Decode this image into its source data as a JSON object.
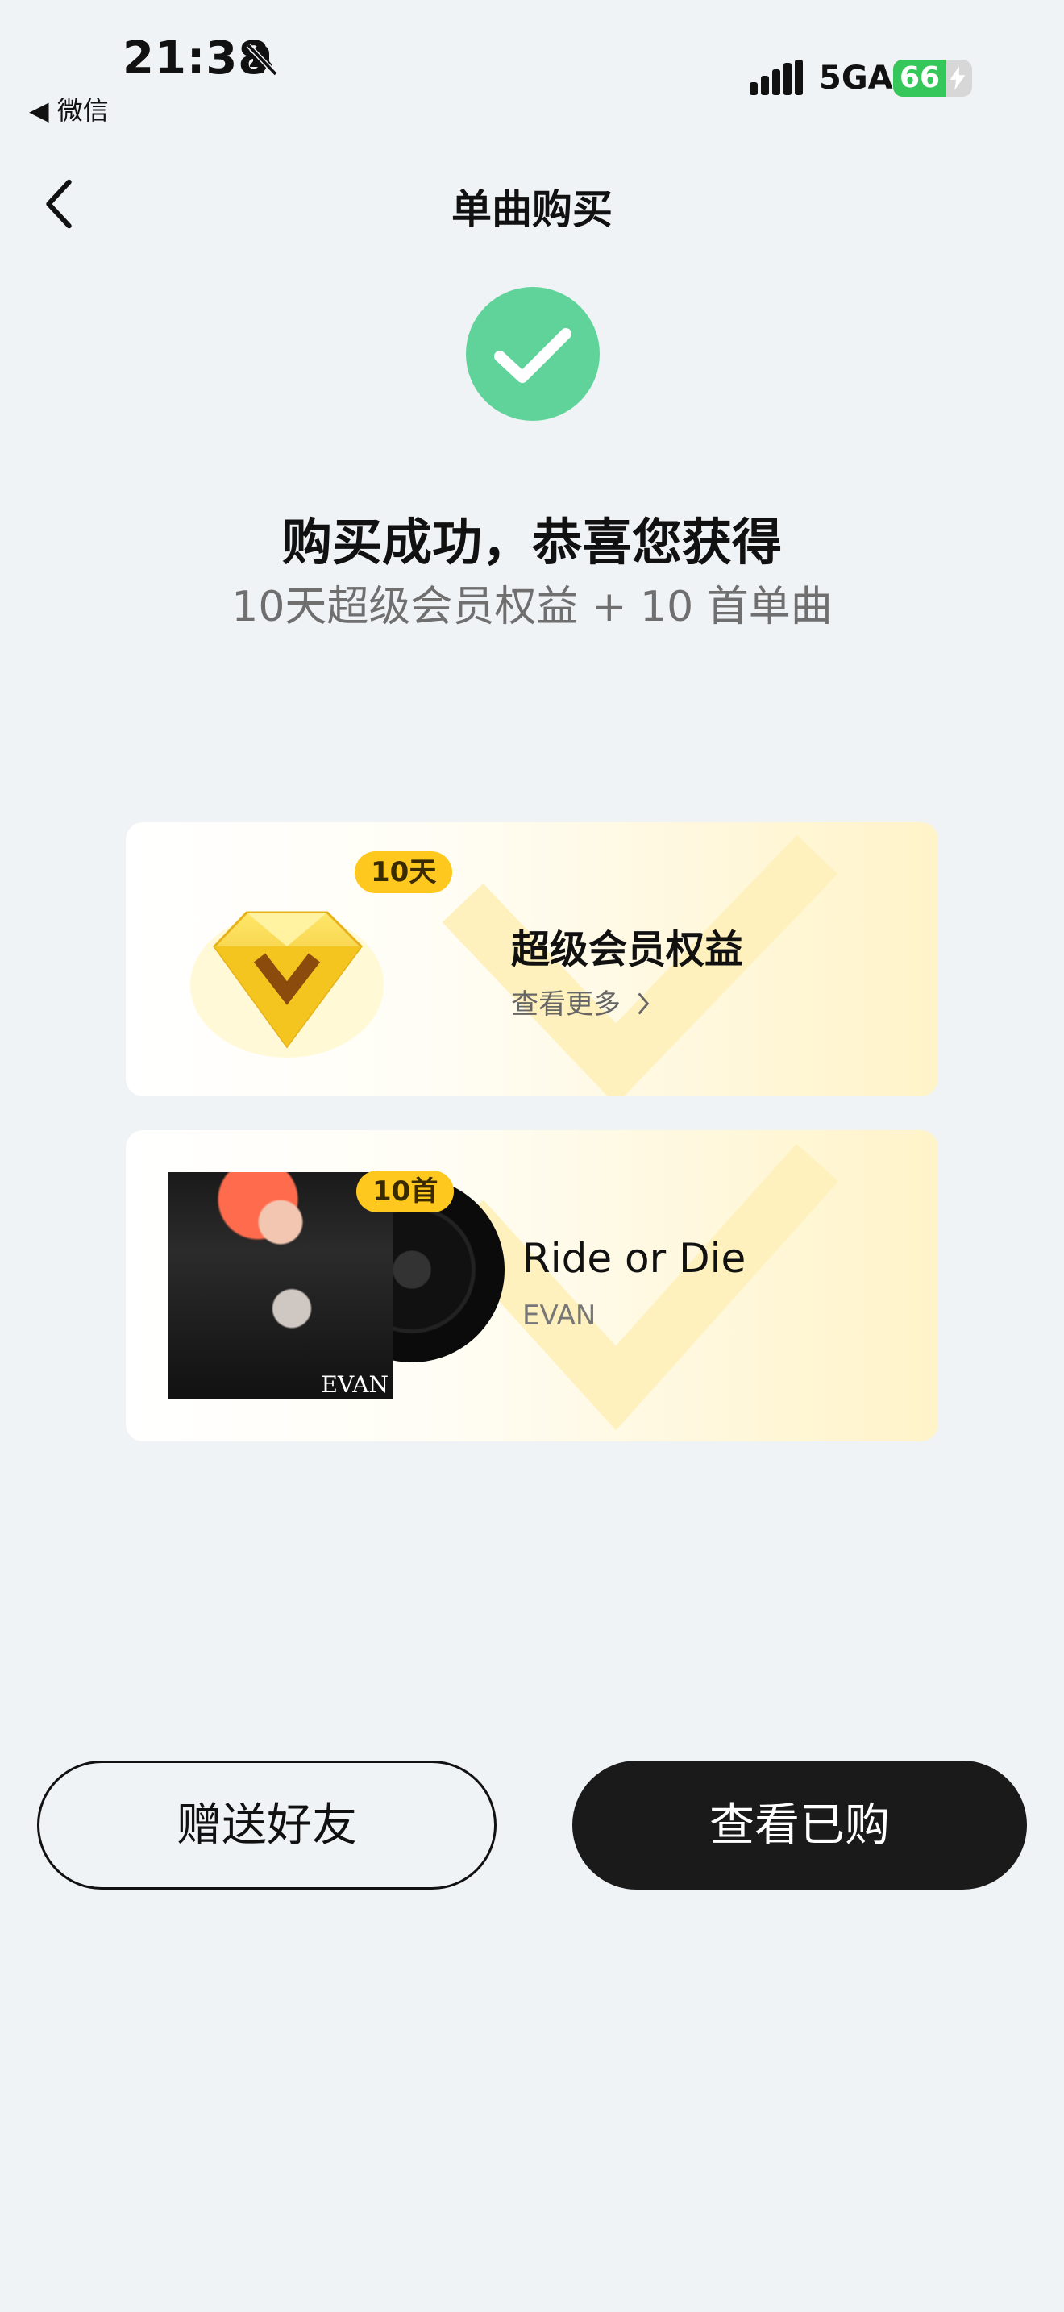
{
  "status_bar": {
    "time": "21:38",
    "back_app": "◀ 微信",
    "network": "5GA",
    "battery_level": 66,
    "battery_text": "66",
    "icons": [
      "bell-muted-icon",
      "signal-icon",
      "charging-bolt-icon"
    ]
  },
  "nav": {
    "title": "单曲购买",
    "back_icon": "chevron-left-icon"
  },
  "success": {
    "icon": "check-circle-icon",
    "accent_color": "#5fd39a",
    "title": "购买成功，恭喜您获得",
    "subtitle": "10天超级会员权益 + 10 首单曲"
  },
  "cards": [
    {
      "badge": "10天",
      "title": "超级会员权益",
      "link": "查看更多",
      "icon": "diamond-icon"
    },
    {
      "badge": "10首",
      "title": "Ride or Die",
      "artist": "EVAN",
      "cover_text": "EVAN"
    }
  ],
  "buttons": {
    "gift": "赠送好友",
    "view": "查看已购"
  },
  "colors": {
    "background": "#f0f3f6",
    "badge": "#ffc81e",
    "primary_button": "#1a1a1a"
  }
}
